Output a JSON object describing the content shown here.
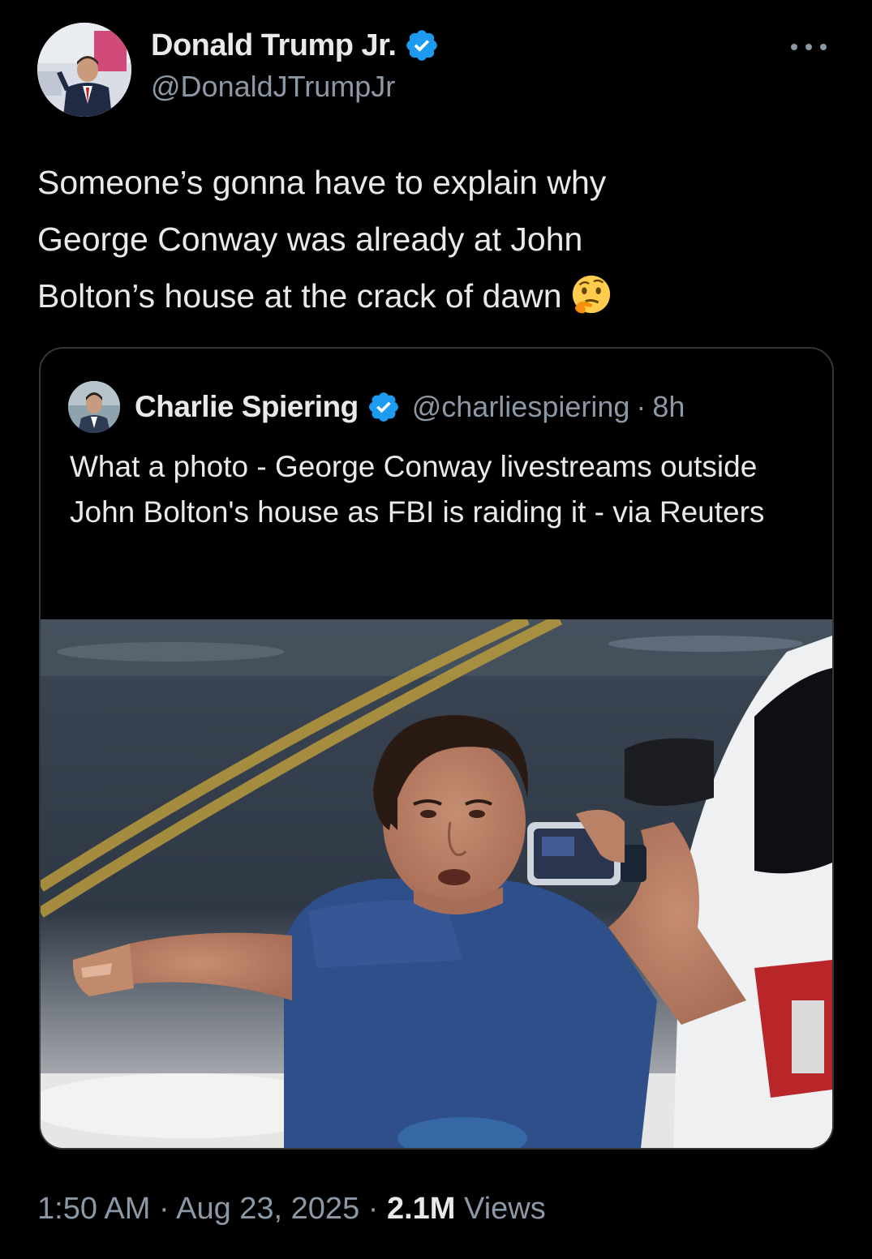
{
  "author": {
    "display_name": "Donald Trump Jr.",
    "handle": "@DonaldJTrumpJr",
    "verified": true,
    "avatar_icon": "profile-photo"
  },
  "tweet": {
    "text": "Someone’s gonna have to explain why\nGeorge Conway was already at John\nBolton’s house at the crack of dawn",
    "emoji": "thinking-face"
  },
  "quote": {
    "display_name": "Charlie Spiering",
    "handle": "@charliespiering",
    "separator": "·",
    "time": "8h",
    "verified": true,
    "text": "What a photo - George Conway livestreams outside John Bolton's house as FBI is raiding it - via Reuters",
    "media": "photo"
  },
  "meta": {
    "time": "1:50 AM",
    "separator": "·",
    "date": "Aug 23, 2025",
    "views_count": "2.1M",
    "views_label": "Views"
  },
  "colors": {
    "background": "#000000",
    "text": "#e7e9ea",
    "secondary_text": "#8b98a5",
    "verified_blue": "#1d9bf0",
    "border": "#333639"
  }
}
